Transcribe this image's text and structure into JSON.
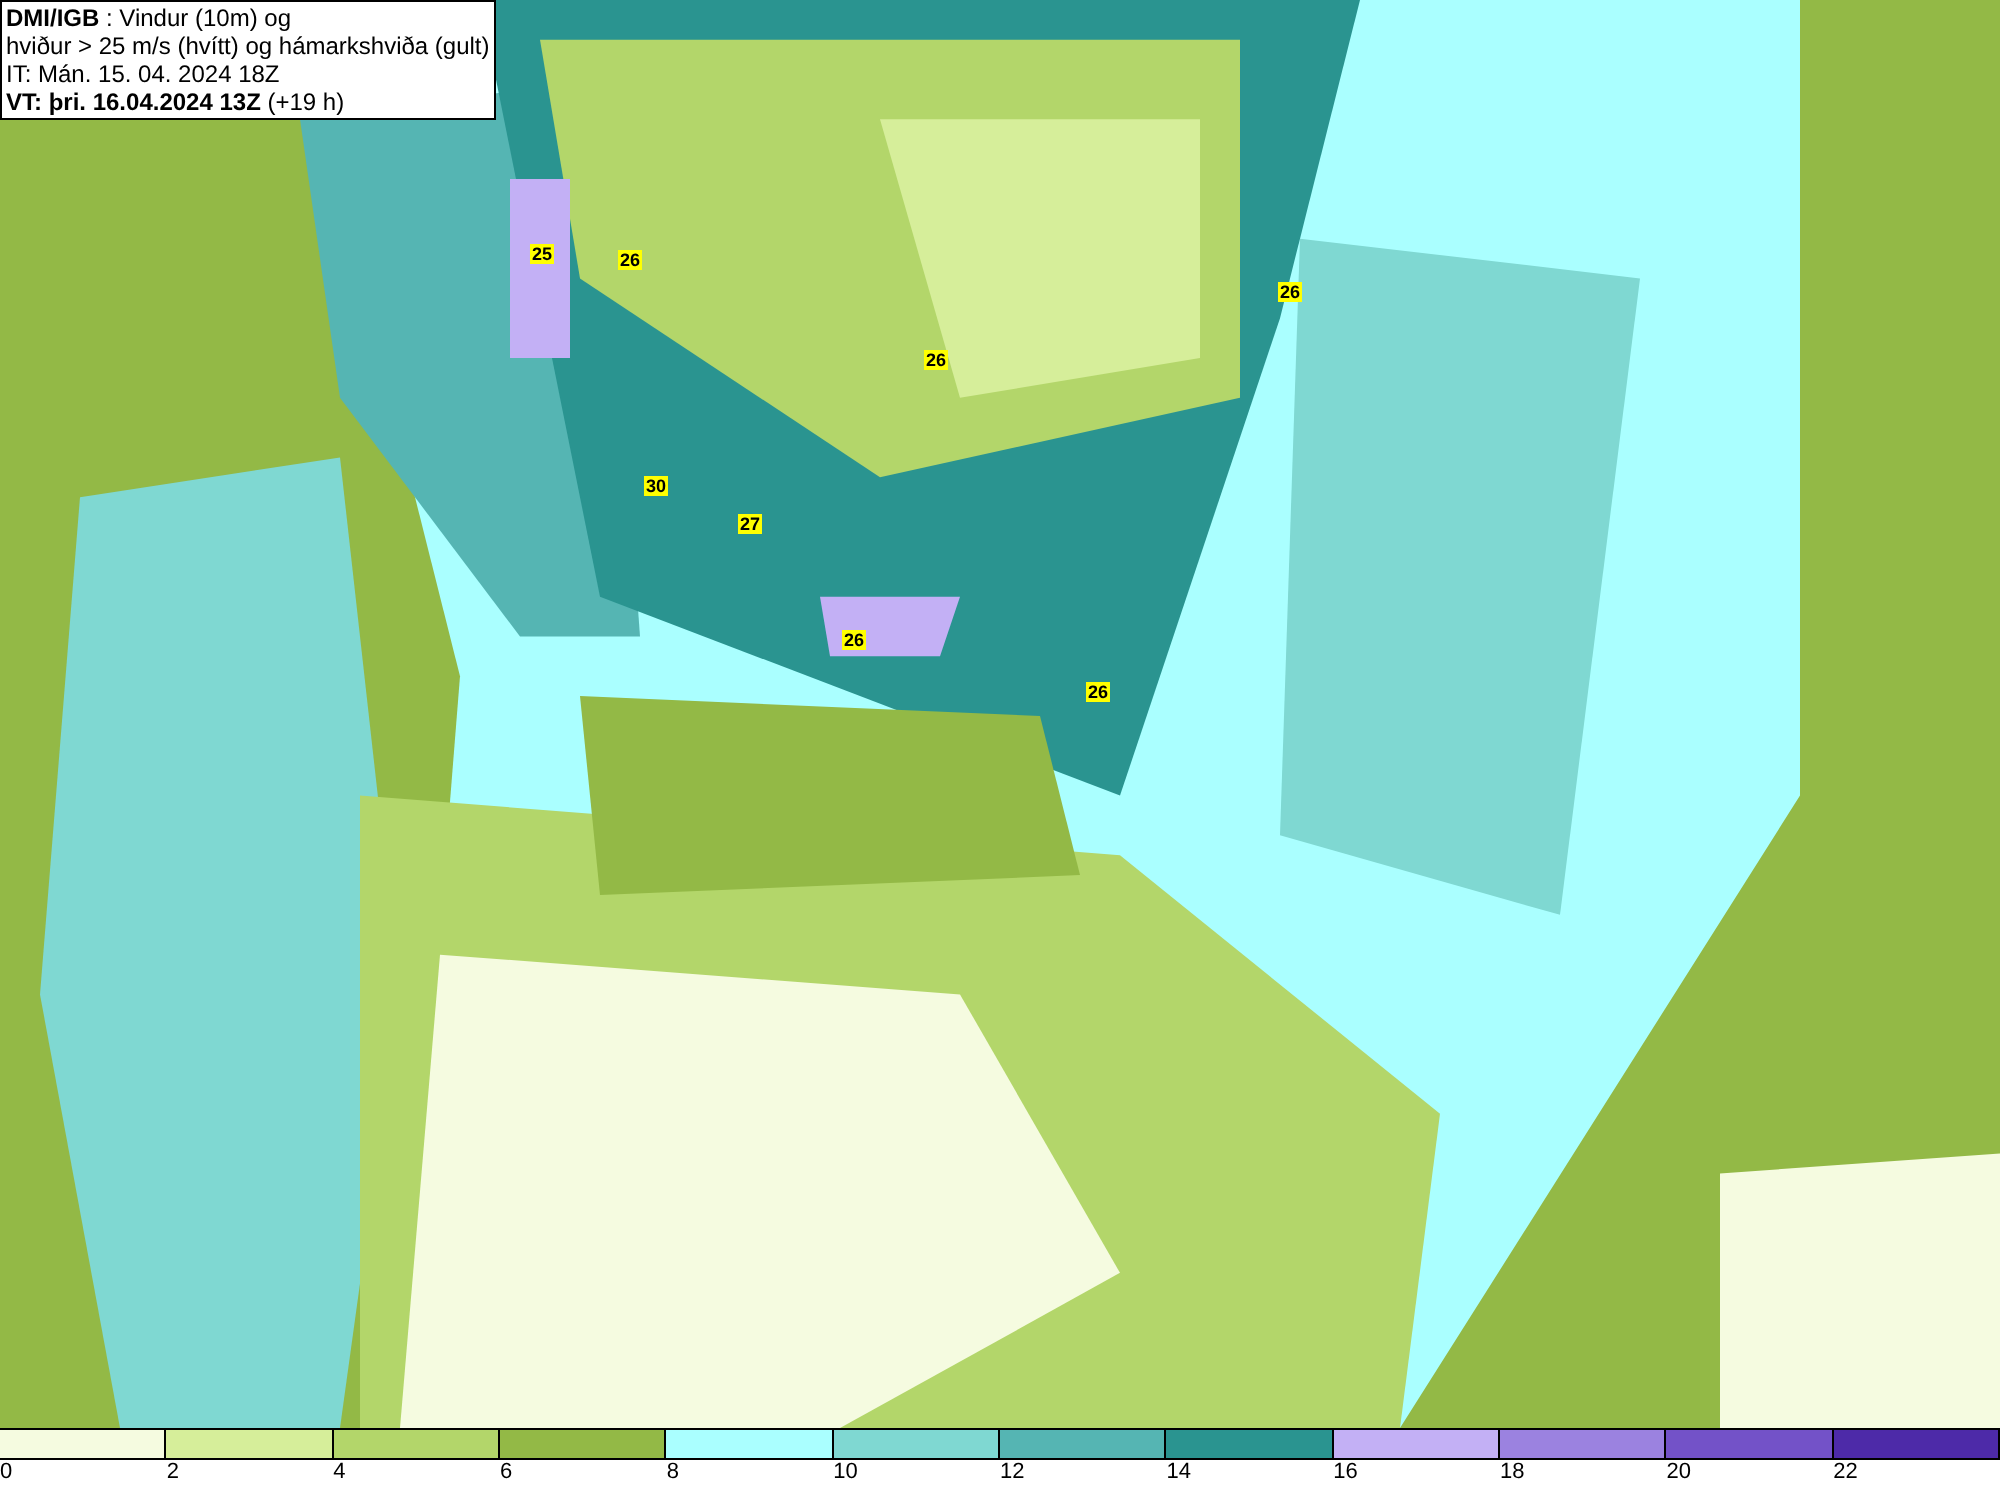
{
  "header": {
    "lines": [
      "**DMI/IGB** : Vindur (10m) og",
      "hviður > 25 m/s (hvítt) og hámarkshviða (gult)",
      "IT: Mán. 15. 04. 2024 18Z",
      "**VT: þri. 16.04.2024 13Z** (+19 h)"
    ]
  },
  "gust_labels": [
    {
      "text": "25"
    },
    {
      "text": "26"
    },
    {
      "text": "26"
    },
    {
      "text": "26"
    },
    {
      "text": "30"
    },
    {
      "text": "27"
    },
    {
      "text": "26"
    },
    {
      "text": "26"
    }
  ],
  "legend": [
    {
      "label": "0",
      "color": "#f5fbe0"
    },
    {
      "label": "2",
      "color": "#d6ee9a"
    },
    {
      "label": "4",
      "color": "#b3d66a"
    },
    {
      "label": "6",
      "color": "#93b946"
    },
    {
      "label": "8",
      "color": "#aaffff"
    },
    {
      "label": "10",
      "color": "#7fd8d2"
    },
    {
      "label": "12",
      "color": "#55b5b3"
    },
    {
      "label": "14",
      "color": "#2a9490"
    },
    {
      "label": "16",
      "color": "#c3b0f5"
    },
    {
      "label": "18",
      "color": "#9b82e0"
    },
    {
      "label": "20",
      "color": "#7352c8"
    },
    {
      "label": "22",
      "color": "#4d2aa8"
    }
  ]
}
